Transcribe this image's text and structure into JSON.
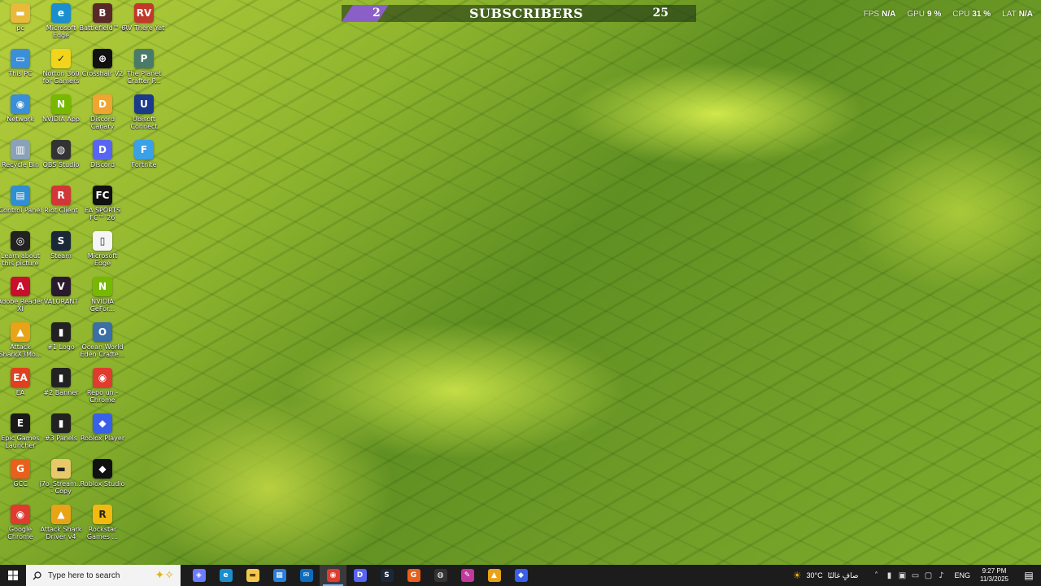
{
  "desktop_icons": [
    {
      "label": "pc",
      "icon": "folder-icon",
      "color": "#e8b93a",
      "glyph": "▬"
    },
    {
      "label": "This PC",
      "icon": "monitor-icon",
      "color": "#3a8fd8",
      "glyph": "▭"
    },
    {
      "label": "Network",
      "icon": "network-icon",
      "color": "#3a8fd8",
      "glyph": "◉"
    },
    {
      "label": "Recycle Bin",
      "icon": "recycle-bin-icon",
      "color": "#8aa2b8",
      "glyph": "▥"
    },
    {
      "label": "Control Panel",
      "icon": "control-panel-icon",
      "color": "#2f8fd0",
      "glyph": "▤"
    },
    {
      "label": "Learn about this picture",
      "icon": "camera-icon",
      "color": "#222222",
      "glyph": "◎"
    },
    {
      "label": "Adobe Reader XI",
      "icon": "adobe-reader-icon",
      "color": "#c8102e",
      "glyph": "A"
    },
    {
      "label": "Attack SharkX3Mo...",
      "icon": "attack-shark-icon",
      "color": "#e8a317",
      "glyph": "▲"
    },
    {
      "label": "EA",
      "icon": "ea-icon",
      "color": "#e04020",
      "glyph": "EA"
    },
    {
      "label": "Epic Games Launcher",
      "icon": "epic-games-icon",
      "color": "#1a1a1a",
      "glyph": "E"
    },
    {
      "label": "GCC",
      "icon": "gcc-icon",
      "color": "#e8601c",
      "glyph": "G"
    },
    {
      "label": "Google Chrome",
      "icon": "chrome-icon",
      "color": "#e03b2f",
      "glyph": "◉"
    },
    {
      "label": "Microsoft Edge",
      "icon": "edge-icon",
      "color": "#1a8fd0",
      "glyph": "e"
    },
    {
      "label": "Norton 360 for Gamers",
      "icon": "norton-icon",
      "color": "#f2d51a",
      "glyph": "✓"
    },
    {
      "label": "NVIDIA App",
      "icon": "nvidia-icon",
      "color": "#76b900",
      "glyph": "N"
    },
    {
      "label": "OBS Studio",
      "icon": "obs-icon",
      "color": "#333333",
      "glyph": "◍"
    },
    {
      "label": "Riot Client",
      "icon": "riot-icon",
      "color": "#d13639",
      "glyph": "R"
    },
    {
      "label": "Steam",
      "icon": "steam-icon",
      "color": "#1b2838",
      "glyph": "S"
    },
    {
      "label": "VALORANT",
      "icon": "valorant-icon",
      "color": "#2a1a2e",
      "glyph": "V"
    },
    {
      "label": "#1 Logo",
      "icon": "file-icon",
      "color": "#222222",
      "glyph": "▮"
    },
    {
      "label": "#2 Banner",
      "icon": "file-icon",
      "color": "#222222",
      "glyph": "▮"
    },
    {
      "label": "#3 Panels",
      "icon": "file-icon",
      "color": "#222222",
      "glyph": "▮"
    },
    {
      "label": "j7o_Stream... - Copy",
      "icon": "folder-icon",
      "color": "#e8c96a",
      "glyph": "▬"
    },
    {
      "label": "Attack Shark Driver v4",
      "icon": "attack-shark-icon",
      "color": "#e8a317",
      "glyph": "▲"
    },
    {
      "label": "Battlefield™ 6",
      "icon": "battlefield-icon",
      "color": "#5a2a2a",
      "glyph": "B"
    },
    {
      "label": "Crosshair V2",
      "icon": "crosshair-icon",
      "color": "#111111",
      "glyph": "⊕"
    },
    {
      "label": "Discord Canary",
      "icon": "discord-canary-icon",
      "color": "#f0a530",
      "glyph": "D"
    },
    {
      "label": "Discord",
      "icon": "discord-icon",
      "color": "#5865f2",
      "glyph": "D"
    },
    {
      "label": "EA SPORTS FC™ 26",
      "icon": "ea-fc-icon",
      "color": "#111111",
      "glyph": "FC"
    },
    {
      "label": "Microsoft Edge",
      "icon": "file-icon",
      "color": "#f5f5f5",
      "glyph": "▯"
    },
    {
      "label": "NVIDIA GeFor...",
      "icon": "nvidia-icon",
      "color": "#76b900",
      "glyph": "N"
    },
    {
      "label": "Ocean World Eden Crafte...",
      "icon": "ocean-world-icon",
      "color": "#3a6fa8",
      "glyph": "O"
    },
    {
      "label": "Repo un - Chrome",
      "icon": "chrome-icon",
      "color": "#e03b2f",
      "glyph": "◉"
    },
    {
      "label": "Roblox Player",
      "icon": "roblox-icon",
      "color": "#3860e8",
      "glyph": "◆"
    },
    {
      "label": "Roblox Studio",
      "icon": "roblox-studio-icon",
      "color": "#111111",
      "glyph": "◆"
    },
    {
      "label": "Rockstar Games ...",
      "icon": "rockstar-icon",
      "color": "#f2b90f",
      "glyph": "R"
    },
    {
      "label": "RV There Yet",
      "icon": "rv-there-yet-icon",
      "color": "#c0392b",
      "glyph": "RV"
    },
    {
      "label": "The Planet Crafter P...",
      "icon": "planet-crafter-icon",
      "color": "#4a7a6a",
      "glyph": "P"
    },
    {
      "label": "Ubisoft Connect",
      "icon": "ubisoft-icon",
      "color": "#1a3a8a",
      "glyph": "U"
    },
    {
      "label": "Fortnite",
      "icon": "fortnite-icon",
      "color": "#3aa0e8",
      "glyph": "F"
    }
  ],
  "subscriber_banner": {
    "left_number": "2",
    "title": "SUBSCRIBERS",
    "right_number": "25"
  },
  "perf_overlay": [
    {
      "name": "FPS",
      "value": "N/A"
    },
    {
      "name": "GPU",
      "value": "9 %"
    },
    {
      "name": "CPU",
      "value": "31 %"
    },
    {
      "name": "LAT",
      "value": "N/A"
    }
  ],
  "taskbar": {
    "search_placeholder": "Type here to search",
    "pinned": [
      {
        "name": "copilot-icon",
        "color": "#6b7cff",
        "glyph": "◈"
      },
      {
        "name": "edge-icon",
        "color": "#1a8fd0",
        "glyph": "e"
      },
      {
        "name": "file-explorer-icon",
        "color": "#f2c94c",
        "glyph": "▬"
      },
      {
        "name": "store-icon",
        "color": "#2a7fd8",
        "glyph": "▦"
      },
      {
        "name": "outlook-icon",
        "color": "#0f6cbd",
        "glyph": "✉"
      },
      {
        "name": "chrome-icon",
        "color": "#e03b2f",
        "glyph": "◉",
        "active": true
      },
      {
        "name": "discord-icon",
        "color": "#5865f2",
        "glyph": "D"
      },
      {
        "name": "steam-icon",
        "color": "#1b2838",
        "glyph": "S"
      },
      {
        "name": "gcc-icon",
        "color": "#e8601c",
        "glyph": "G"
      },
      {
        "name": "obs-icon",
        "color": "#333333",
        "glyph": "◍"
      },
      {
        "name": "pen-icon",
        "color": "#c0399b",
        "glyph": "✎"
      },
      {
        "name": "attack-shark-icon",
        "color": "#e8a317",
        "glyph": "▲"
      },
      {
        "name": "roblox-icon",
        "color": "#3860e8",
        "glyph": "◆"
      }
    ],
    "weather": {
      "temp": "30°C",
      "desc": "صافٍ غالبًا"
    },
    "language": "ENG",
    "time": "9:27 PM",
    "date": "11/3/2025"
  }
}
